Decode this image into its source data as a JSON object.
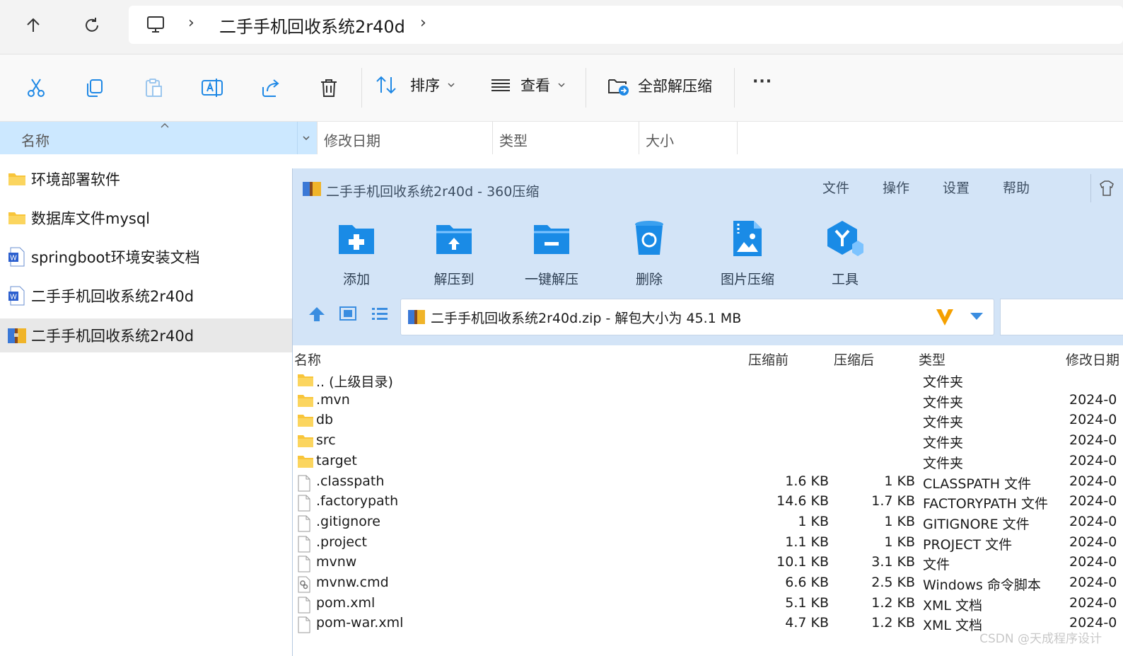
{
  "address": {
    "breadcrumb_title": "二手手机回收系统2r40d",
    "separator_glyph": "›"
  },
  "toolbar": {
    "sort_label": "排序",
    "view_label": "查看",
    "extract_all_label": "全部解压缩",
    "more_label": "···"
  },
  "columns": {
    "name": "名称",
    "modified": "修改日期",
    "type": "类型",
    "size": "大小"
  },
  "files": [
    {
      "name": "环境部署软件",
      "icon": "folder-icon"
    },
    {
      "name": "数据库文件mysql",
      "icon": "folder-icon"
    },
    {
      "name": "springboot环境安装文档",
      "icon": "word-doc-icon"
    },
    {
      "name": "二手手机回收系统2r40d",
      "icon": "word-doc-icon"
    },
    {
      "name": "二手手机回收系统2r40d",
      "icon": "zip-archive-icon",
      "selected": true
    }
  ],
  "zip_window": {
    "title": "二手手机回收系统2r40d - 360压缩",
    "menu": [
      "文件",
      "操作",
      "设置",
      "帮助"
    ],
    "ribbon": [
      {
        "label": "添加",
        "icon": "add-folder-icon"
      },
      {
        "label": "解压到",
        "icon": "extract-to-icon"
      },
      {
        "label": "一键解压",
        "icon": "quick-extract-icon"
      },
      {
        "label": "删除",
        "icon": "recycle-bin-icon"
      },
      {
        "label": "图片压缩",
        "icon": "image-compress-icon"
      },
      {
        "label": "工具",
        "icon": "tools-icon"
      }
    ],
    "path_text": "二手手机回收系统2r40d.zip - 解包大小为 45.1 MB",
    "list_headers": {
      "name": "名称",
      "before": "压缩前",
      "after": "压缩后",
      "type": "类型",
      "date": "修改日期"
    },
    "rows": [
      {
        "name": ".. (上级目录)",
        "before": "",
        "after": "",
        "type": "文件夹",
        "date": "",
        "icon": "folder-icon"
      },
      {
        "name": ".mvn",
        "before": "",
        "after": "",
        "type": "文件夹",
        "date": "2024-0",
        "icon": "folder-icon"
      },
      {
        "name": "db",
        "before": "",
        "after": "",
        "type": "文件夹",
        "date": "2024-0",
        "icon": "folder-icon"
      },
      {
        "name": "src",
        "before": "",
        "after": "",
        "type": "文件夹",
        "date": "2024-0",
        "icon": "folder-icon"
      },
      {
        "name": "target",
        "before": "",
        "after": "",
        "type": "文件夹",
        "date": "2024-0",
        "icon": "folder-icon"
      },
      {
        "name": ".classpath",
        "before": "1.6 KB",
        "after": "1 KB",
        "type": "CLASSPATH 文件",
        "date": "2024-0",
        "icon": "file-icon"
      },
      {
        "name": ".factorypath",
        "before": "14.6 KB",
        "after": "1.7 KB",
        "type": "FACTORYPATH 文件",
        "date": "2024-0",
        "icon": "file-icon"
      },
      {
        "name": ".gitignore",
        "before": "1 KB",
        "after": "1 KB",
        "type": "GITIGNORE 文件",
        "date": "2024-0",
        "icon": "file-icon"
      },
      {
        "name": ".project",
        "before": "1.1 KB",
        "after": "1 KB",
        "type": "PROJECT 文件",
        "date": "2024-0",
        "icon": "file-icon"
      },
      {
        "name": "mvnw",
        "before": "10.1 KB",
        "after": "3.1 KB",
        "type": "文件",
        "date": "2024-0",
        "icon": "file-icon"
      },
      {
        "name": "mvnw.cmd",
        "before": "6.6 KB",
        "after": "2.5 KB",
        "type": "Windows 命令脚本",
        "date": "2024-0",
        "icon": "script-file-icon"
      },
      {
        "name": "pom.xml",
        "before": "5.1 KB",
        "after": "1.2 KB",
        "type": "XML 文档",
        "date": "2024-0",
        "icon": "file-icon"
      },
      {
        "name": "pom-war.xml",
        "before": "4.7 KB",
        "after": "1.2 KB",
        "type": "XML 文档",
        "date": "2024-0",
        "icon": "file-icon"
      }
    ]
  },
  "watermark": "CSDN @天成程序设计",
  "colors": {
    "accent_blue": "#1e88e5",
    "selection": "#cce8ff",
    "zip_chrome": "#d3e4f7",
    "folder_yellow": "#f8c53a"
  }
}
